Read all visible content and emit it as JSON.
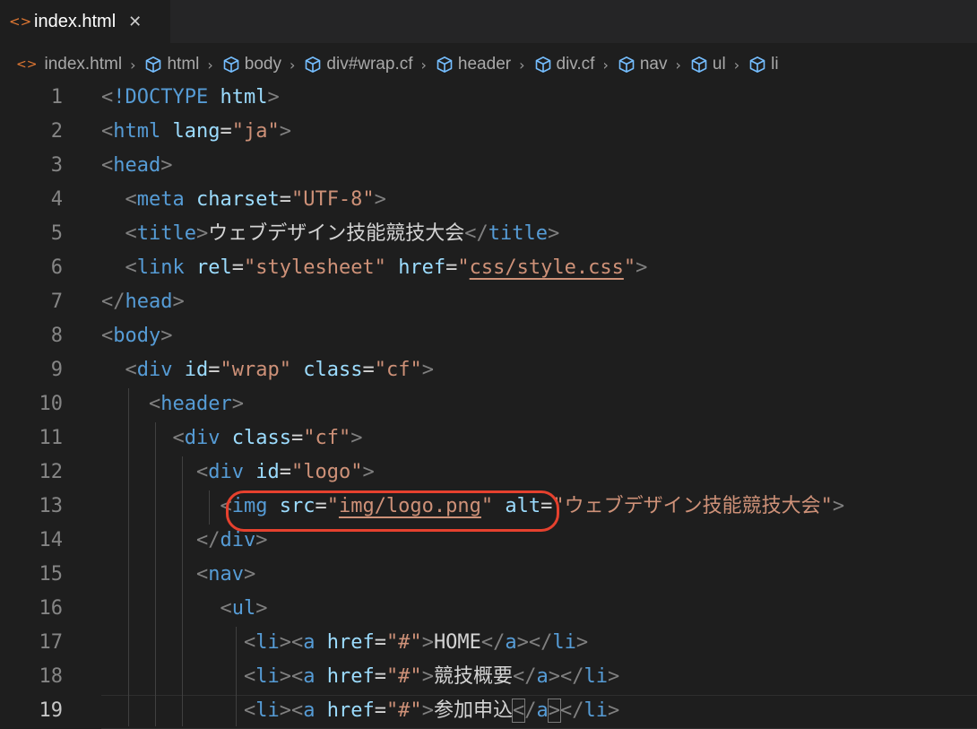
{
  "tab": {
    "icon": "html-file-icon",
    "label": "index.html",
    "close": "✕"
  },
  "breadcrumb": [
    {
      "label": "index.html",
      "icon": "html-file-icon"
    },
    {
      "label": "html",
      "icon": "element-cube-icon"
    },
    {
      "label": "body",
      "icon": "element-cube-icon"
    },
    {
      "label": "div#wrap.cf",
      "icon": "element-cube-icon"
    },
    {
      "label": "header",
      "icon": "element-cube-icon"
    },
    {
      "label": "div.cf",
      "icon": "element-cube-icon"
    },
    {
      "label": "nav",
      "icon": "element-cube-icon"
    },
    {
      "label": "ul",
      "icon": "element-cube-icon"
    },
    {
      "label": "li",
      "icon": "element-cube-icon"
    }
  ],
  "editor": {
    "active_line": 19,
    "lines": [
      {
        "n": "1",
        "tokens": [
          [
            "br",
            "<"
          ],
          [
            "tag",
            "!DOCTYPE"
          ],
          [
            "txt",
            " "
          ],
          [
            "attr",
            "html"
          ],
          [
            "br",
            ">"
          ]
        ]
      },
      {
        "n": "2",
        "tokens": [
          [
            "br",
            "<"
          ],
          [
            "tag",
            "html"
          ],
          [
            "txt",
            " "
          ],
          [
            "attr",
            "lang"
          ],
          [
            "txt",
            "="
          ],
          [
            "str",
            "\"ja\""
          ],
          [
            "br",
            ">"
          ]
        ]
      },
      {
        "n": "3",
        "tokens": [
          [
            "br",
            "<"
          ],
          [
            "tag",
            "head"
          ],
          [
            "br",
            ">"
          ]
        ]
      },
      {
        "n": "4",
        "tokens": [
          [
            "txt",
            "  "
          ],
          [
            "br",
            "<"
          ],
          [
            "tag",
            "meta"
          ],
          [
            "txt",
            " "
          ],
          [
            "attr",
            "charset"
          ],
          [
            "txt",
            "="
          ],
          [
            "str",
            "\"UTF-8\""
          ],
          [
            "br",
            ">"
          ]
        ]
      },
      {
        "n": "5",
        "tokens": [
          [
            "txt",
            "  "
          ],
          [
            "br",
            "<"
          ],
          [
            "tag",
            "title"
          ],
          [
            "br",
            ">"
          ],
          [
            "txt",
            "ウェブデザイン技能競技大会"
          ],
          [
            "br",
            "</"
          ],
          [
            "tag",
            "title"
          ],
          [
            "br",
            ">"
          ]
        ]
      },
      {
        "n": "6",
        "tokens": [
          [
            "txt",
            "  "
          ],
          [
            "br",
            "<"
          ],
          [
            "tag",
            "link"
          ],
          [
            "txt",
            " "
          ],
          [
            "attr",
            "rel"
          ],
          [
            "txt",
            "="
          ],
          [
            "str",
            "\"stylesheet\""
          ],
          [
            "txt",
            " "
          ],
          [
            "attr",
            "href"
          ],
          [
            "txt",
            "="
          ],
          [
            "str",
            "\""
          ],
          [
            "strlink",
            "css/style.css"
          ],
          [
            "str",
            "\""
          ],
          [
            "br",
            ">"
          ]
        ]
      },
      {
        "n": "7",
        "tokens": [
          [
            "br",
            "</"
          ],
          [
            "tag",
            "head"
          ],
          [
            "br",
            ">"
          ]
        ]
      },
      {
        "n": "8",
        "tokens": [
          [
            "br",
            "<"
          ],
          [
            "tag",
            "body"
          ],
          [
            "br",
            ">"
          ]
        ]
      },
      {
        "n": "9",
        "tokens": [
          [
            "txt",
            "  "
          ],
          [
            "br",
            "<"
          ],
          [
            "tag",
            "div"
          ],
          [
            "txt",
            " "
          ],
          [
            "attr",
            "id"
          ],
          [
            "txt",
            "="
          ],
          [
            "str",
            "\"wrap\""
          ],
          [
            "txt",
            " "
          ],
          [
            "attr",
            "class"
          ],
          [
            "txt",
            "="
          ],
          [
            "str",
            "\"cf\""
          ],
          [
            "br",
            ">"
          ]
        ]
      },
      {
        "n": "10",
        "tokens": [
          [
            "txt",
            "    "
          ],
          [
            "br",
            "<"
          ],
          [
            "tag",
            "header"
          ],
          [
            "br",
            ">"
          ]
        ]
      },
      {
        "n": "11",
        "tokens": [
          [
            "txt",
            "      "
          ],
          [
            "br",
            "<"
          ],
          [
            "tag",
            "div"
          ],
          [
            "txt",
            " "
          ],
          [
            "attr",
            "class"
          ],
          [
            "txt",
            "="
          ],
          [
            "str",
            "\"cf\""
          ],
          [
            "br",
            ">"
          ]
        ]
      },
      {
        "n": "12",
        "tokens": [
          [
            "txt",
            "        "
          ],
          [
            "br",
            "<"
          ],
          [
            "tag",
            "div"
          ],
          [
            "txt",
            " "
          ],
          [
            "attr",
            "id"
          ],
          [
            "txt",
            "="
          ],
          [
            "str",
            "\"logo\""
          ],
          [
            "br",
            ">"
          ]
        ]
      },
      {
        "n": "13",
        "tokens": [
          [
            "txt",
            "          "
          ],
          [
            "br",
            "<"
          ],
          [
            "tag",
            "img"
          ],
          [
            "txt",
            " "
          ],
          [
            "attr",
            "src"
          ],
          [
            "txt",
            "="
          ],
          [
            "str",
            "\""
          ],
          [
            "strlink",
            "img/logo.png"
          ],
          [
            "str",
            "\""
          ],
          [
            "txt",
            " "
          ],
          [
            "attr",
            "alt"
          ],
          [
            "txt",
            "="
          ],
          [
            "str",
            "\"ウェブデザイン技能競技大会\""
          ],
          [
            "br",
            ">"
          ]
        ]
      },
      {
        "n": "14",
        "tokens": [
          [
            "txt",
            "        "
          ],
          [
            "br",
            "</"
          ],
          [
            "tag",
            "div"
          ],
          [
            "br",
            ">"
          ]
        ]
      },
      {
        "n": "15",
        "tokens": [
          [
            "txt",
            "        "
          ],
          [
            "br",
            "<"
          ],
          [
            "tag",
            "nav"
          ],
          [
            "br",
            ">"
          ]
        ]
      },
      {
        "n": "16",
        "tokens": [
          [
            "txt",
            "          "
          ],
          [
            "br",
            "<"
          ],
          [
            "tag",
            "ul"
          ],
          [
            "br",
            ">"
          ]
        ]
      },
      {
        "n": "17",
        "tokens": [
          [
            "txt",
            "            "
          ],
          [
            "br",
            "<"
          ],
          [
            "tag",
            "li"
          ],
          [
            "br",
            "><"
          ],
          [
            "tag",
            "a"
          ],
          [
            "txt",
            " "
          ],
          [
            "attr",
            "href"
          ],
          [
            "txt",
            "="
          ],
          [
            "str",
            "\"#\""
          ],
          [
            "br",
            ">"
          ],
          [
            "txt",
            "HOME"
          ],
          [
            "br",
            "</"
          ],
          [
            "tag",
            "a"
          ],
          [
            "br",
            "></"
          ],
          [
            "tag",
            "li"
          ],
          [
            "br",
            ">"
          ]
        ]
      },
      {
        "n": "18",
        "tokens": [
          [
            "txt",
            "            "
          ],
          [
            "br",
            "<"
          ],
          [
            "tag",
            "li"
          ],
          [
            "br",
            "><"
          ],
          [
            "tag",
            "a"
          ],
          [
            "txt",
            " "
          ],
          [
            "attr",
            "href"
          ],
          [
            "txt",
            "="
          ],
          [
            "str",
            "\"#\""
          ],
          [
            "br",
            ">"
          ],
          [
            "txt",
            "競技概要"
          ],
          [
            "br",
            "</"
          ],
          [
            "tag",
            "a"
          ],
          [
            "br",
            "></"
          ],
          [
            "tag",
            "li"
          ],
          [
            "br",
            ">"
          ]
        ]
      },
      {
        "n": "19",
        "tokens": [
          [
            "txt",
            "            "
          ],
          [
            "br",
            "<"
          ],
          [
            "tag",
            "li"
          ],
          [
            "br",
            "><"
          ],
          [
            "tag",
            "a"
          ],
          [
            "txt",
            " "
          ],
          [
            "attr",
            "href"
          ],
          [
            "txt",
            "="
          ],
          [
            "str",
            "\"#\""
          ],
          [
            "br",
            ">"
          ],
          [
            "txt",
            "参加申込"
          ],
          [
            "brm",
            "<"
          ],
          [
            "br",
            "/"
          ],
          [
            "tag",
            "a"
          ],
          [
            "brm",
            ">"
          ],
          [
            "br",
            "</"
          ],
          [
            "tag",
            "li"
          ],
          [
            "br",
            ">"
          ]
        ]
      }
    ]
  }
}
